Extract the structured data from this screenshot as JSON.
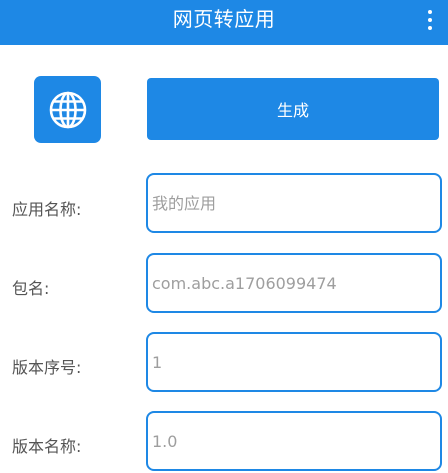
{
  "appbar": {
    "title": "网页转应用",
    "overflow_icon": "more-vertical-icon"
  },
  "app_icon": {
    "icon": "globe-icon",
    "color": "#1e88e5"
  },
  "generate_button": {
    "label": "生成"
  },
  "form": {
    "fields": [
      {
        "label": "应用名称:",
        "placeholder": "我的应用",
        "value": ""
      },
      {
        "label": "包名:",
        "placeholder": "com.abc.a1706099474",
        "value": ""
      },
      {
        "label": "版本序号:",
        "placeholder": "1",
        "value": ""
      },
      {
        "label": "版本名称:",
        "placeholder": "1.0",
        "value": ""
      }
    ]
  },
  "colors": {
    "primary": "#1e88e5",
    "label_text": "#555555",
    "placeholder_text": "#9e9e9e",
    "background": "#ffffff"
  }
}
